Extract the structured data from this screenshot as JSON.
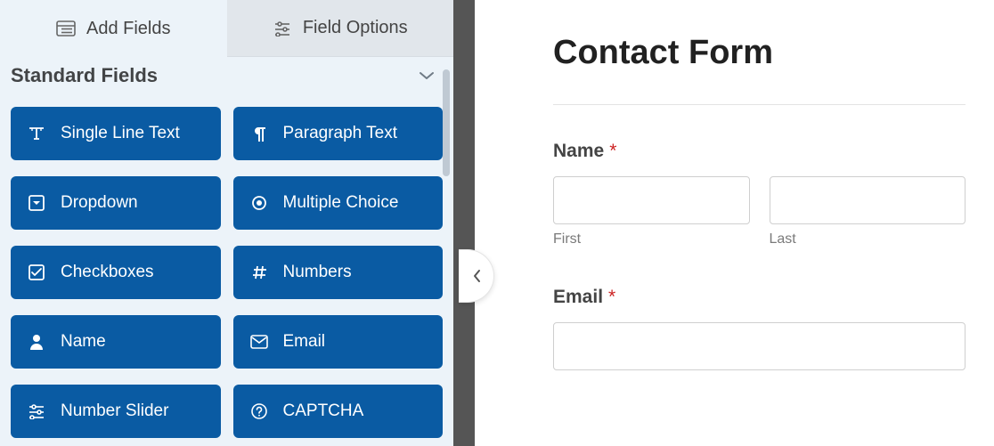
{
  "tabs": {
    "add_fields": "Add Fields",
    "field_options": "Field Options"
  },
  "section": {
    "title": "Standard Fields"
  },
  "fields": [
    {
      "id": "single-line-text",
      "label": "Single Line Text",
      "icon": "text-icon"
    },
    {
      "id": "paragraph-text",
      "label": "Paragraph Text",
      "icon": "paragraph-icon"
    },
    {
      "id": "dropdown",
      "label": "Dropdown",
      "icon": "dropdown-icon"
    },
    {
      "id": "multiple-choice",
      "label": "Multiple Choice",
      "icon": "radio-icon"
    },
    {
      "id": "checkboxes",
      "label": "Checkboxes",
      "icon": "checkbox-icon"
    },
    {
      "id": "numbers",
      "label": "Numbers",
      "icon": "hash-icon"
    },
    {
      "id": "name",
      "label": "Name",
      "icon": "person-icon"
    },
    {
      "id": "email",
      "label": "Email",
      "icon": "envelope-icon"
    },
    {
      "id": "number-slider",
      "label": "Number Slider",
      "icon": "sliders-icon"
    },
    {
      "id": "captcha",
      "label": "CAPTCHA",
      "icon": "question-icon"
    }
  ],
  "preview": {
    "title": "Contact Form",
    "name_field": {
      "label": "Name",
      "required": "*",
      "first": "First",
      "last": "Last"
    },
    "email_field": {
      "label": "Email",
      "required": "*"
    }
  }
}
